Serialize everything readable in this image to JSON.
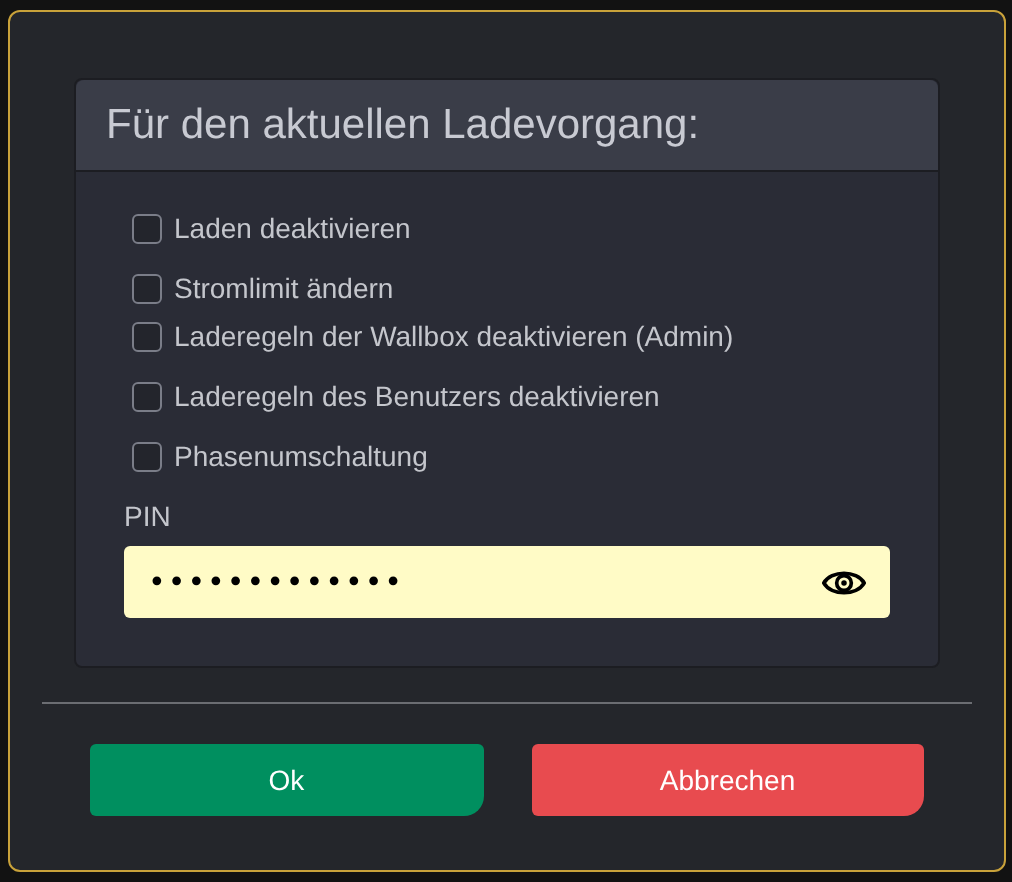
{
  "panel": {
    "title": "Für den aktuellen Ladevorgang:"
  },
  "options": [
    {
      "label": "Laden deaktivieren",
      "checked": false
    },
    {
      "label": "Stromlimit ändern",
      "checked": false
    },
    {
      "label": "Laderegeln der Wallbox deaktivieren (Admin)",
      "checked": false
    },
    {
      "label": "Laderegeln des Benutzers deaktivieren",
      "checked": false
    },
    {
      "label": "Phasenumschaltung",
      "checked": false
    }
  ],
  "pin": {
    "label": "PIN",
    "value": "•••••••••••••"
  },
  "buttons": [
    {
      "label": "Ok",
      "kind": "confirm"
    },
    {
      "label": "Abbrechen",
      "kind": "cancel"
    }
  ]
}
